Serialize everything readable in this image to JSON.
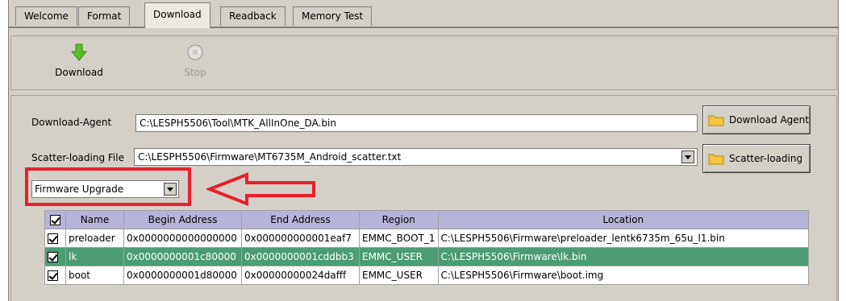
{
  "tabs": [
    {
      "label": "Welcome"
    },
    {
      "label": "Format"
    },
    {
      "label": "Download"
    },
    {
      "label": "Readback"
    },
    {
      "label": "Memory Test"
    }
  ],
  "toolbar": {
    "download_label": "Download",
    "stop_label": "Stop"
  },
  "download_agent": {
    "label": "Download-Agent",
    "value": "C:\\LESPH5506\\Tool\\MTK_AllInOne_DA.bin",
    "button_label": "Download Agent"
  },
  "scatter": {
    "label": "Scatter-loading File",
    "value": "C:\\LESPH5506\\Firmware\\MT6735M_Android_scatter.txt",
    "button_label": "Scatter-loading"
  },
  "mode_select": {
    "value": "Firmware Upgrade"
  },
  "table": {
    "columns": [
      "Name",
      "Begin Address",
      "End Address",
      "Region",
      "Location"
    ],
    "rows": [
      {
        "checked": true,
        "name": "preloader",
        "begin": "0x0000000000000000",
        "end": "0x000000000001eaf7",
        "region": "EMMC_BOOT_1",
        "location": "C:\\LESPH5506\\Firmware\\preloader_lentk6735m_65u_l1.bin",
        "selected": false
      },
      {
        "checked": true,
        "name": "lk",
        "begin": "0x0000000001c80000",
        "end": "0x0000000001cddbb3",
        "region": "EMMC_USER",
        "location": "C:\\LESPH5506\\Firmware\\lk.bin",
        "selected": true
      },
      {
        "checked": true,
        "name": "boot",
        "begin": "0x0000000001d80000",
        "end": "0x00000000024dafff",
        "region": "EMMC_USER",
        "location": "C:\\LESPH5506\\Firmware\\boot.img",
        "selected": false
      }
    ]
  },
  "colors": {
    "annotation_red": "#e8202a",
    "selected_row": "#4c9c74",
    "header_bg": "#b7b4d9"
  }
}
